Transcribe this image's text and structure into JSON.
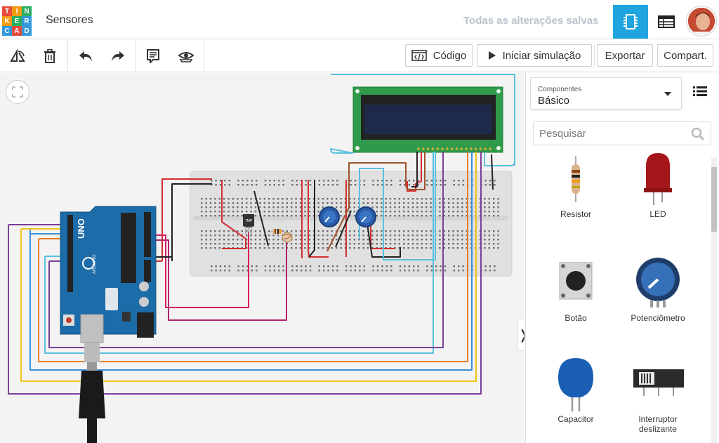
{
  "header": {
    "logo_letters": [
      "T",
      "I",
      "N",
      "K",
      "E",
      "R",
      "C",
      "A",
      "D"
    ],
    "logo_colors": [
      "#e74c3c",
      "#f39c12",
      "#27ae60",
      "#f39c12",
      "#27ae60",
      "#3498db",
      "#3498db",
      "#e74c3c",
      "#3498db"
    ],
    "project_title": "Sensores",
    "save_status": "Todas as alterações salvas",
    "view_buttons": [
      {
        "icon": "circuit-view-icon",
        "active": true
      },
      {
        "icon": "component-list-icon",
        "active": false
      }
    ],
    "accent_color": "#1fa4e0"
  },
  "toolbar": {
    "tools": [
      "rotate-icon",
      "trash-icon",
      "undo-icon",
      "redo-icon",
      "notes-icon",
      "visibility-icon"
    ],
    "code_label": "Código",
    "simulate_label": "Iniciar simulação",
    "export_label": "Exportar",
    "share_label": "Compart."
  },
  "workplane": {
    "fit_icon": "fit-view-icon",
    "collapse_icon": "chevron-right-icon",
    "collapse_glyph": "❭",
    "parts": [
      "Arduino Uno R3",
      "LCD 16x2",
      "breadboard",
      "TMP36",
      "photoresistor",
      "resistor",
      "potentiometer",
      "potentiometer"
    ],
    "arduino_text": "UNO",
    "arduino_text2": "ARDUINO",
    "tmp_label": "TMP"
  },
  "panel": {
    "dropdown_label": "Componentes",
    "dropdown_value": "Básico",
    "search_placeholder": "Pesquisar",
    "components": [
      {
        "name": "Resistor",
        "icon": "resistor-icon"
      },
      {
        "name": "LED",
        "icon": "led-icon"
      },
      {
        "name": "Botão",
        "icon": "pushbutton-icon"
      },
      {
        "name": "Potenciômetro",
        "icon": "potentiometer-icon"
      },
      {
        "name": "Capacitor",
        "icon": "capacitor-icon"
      },
      {
        "name": "Interruptor deslizante",
        "icon": "slide-switch-icon"
      }
    ]
  }
}
